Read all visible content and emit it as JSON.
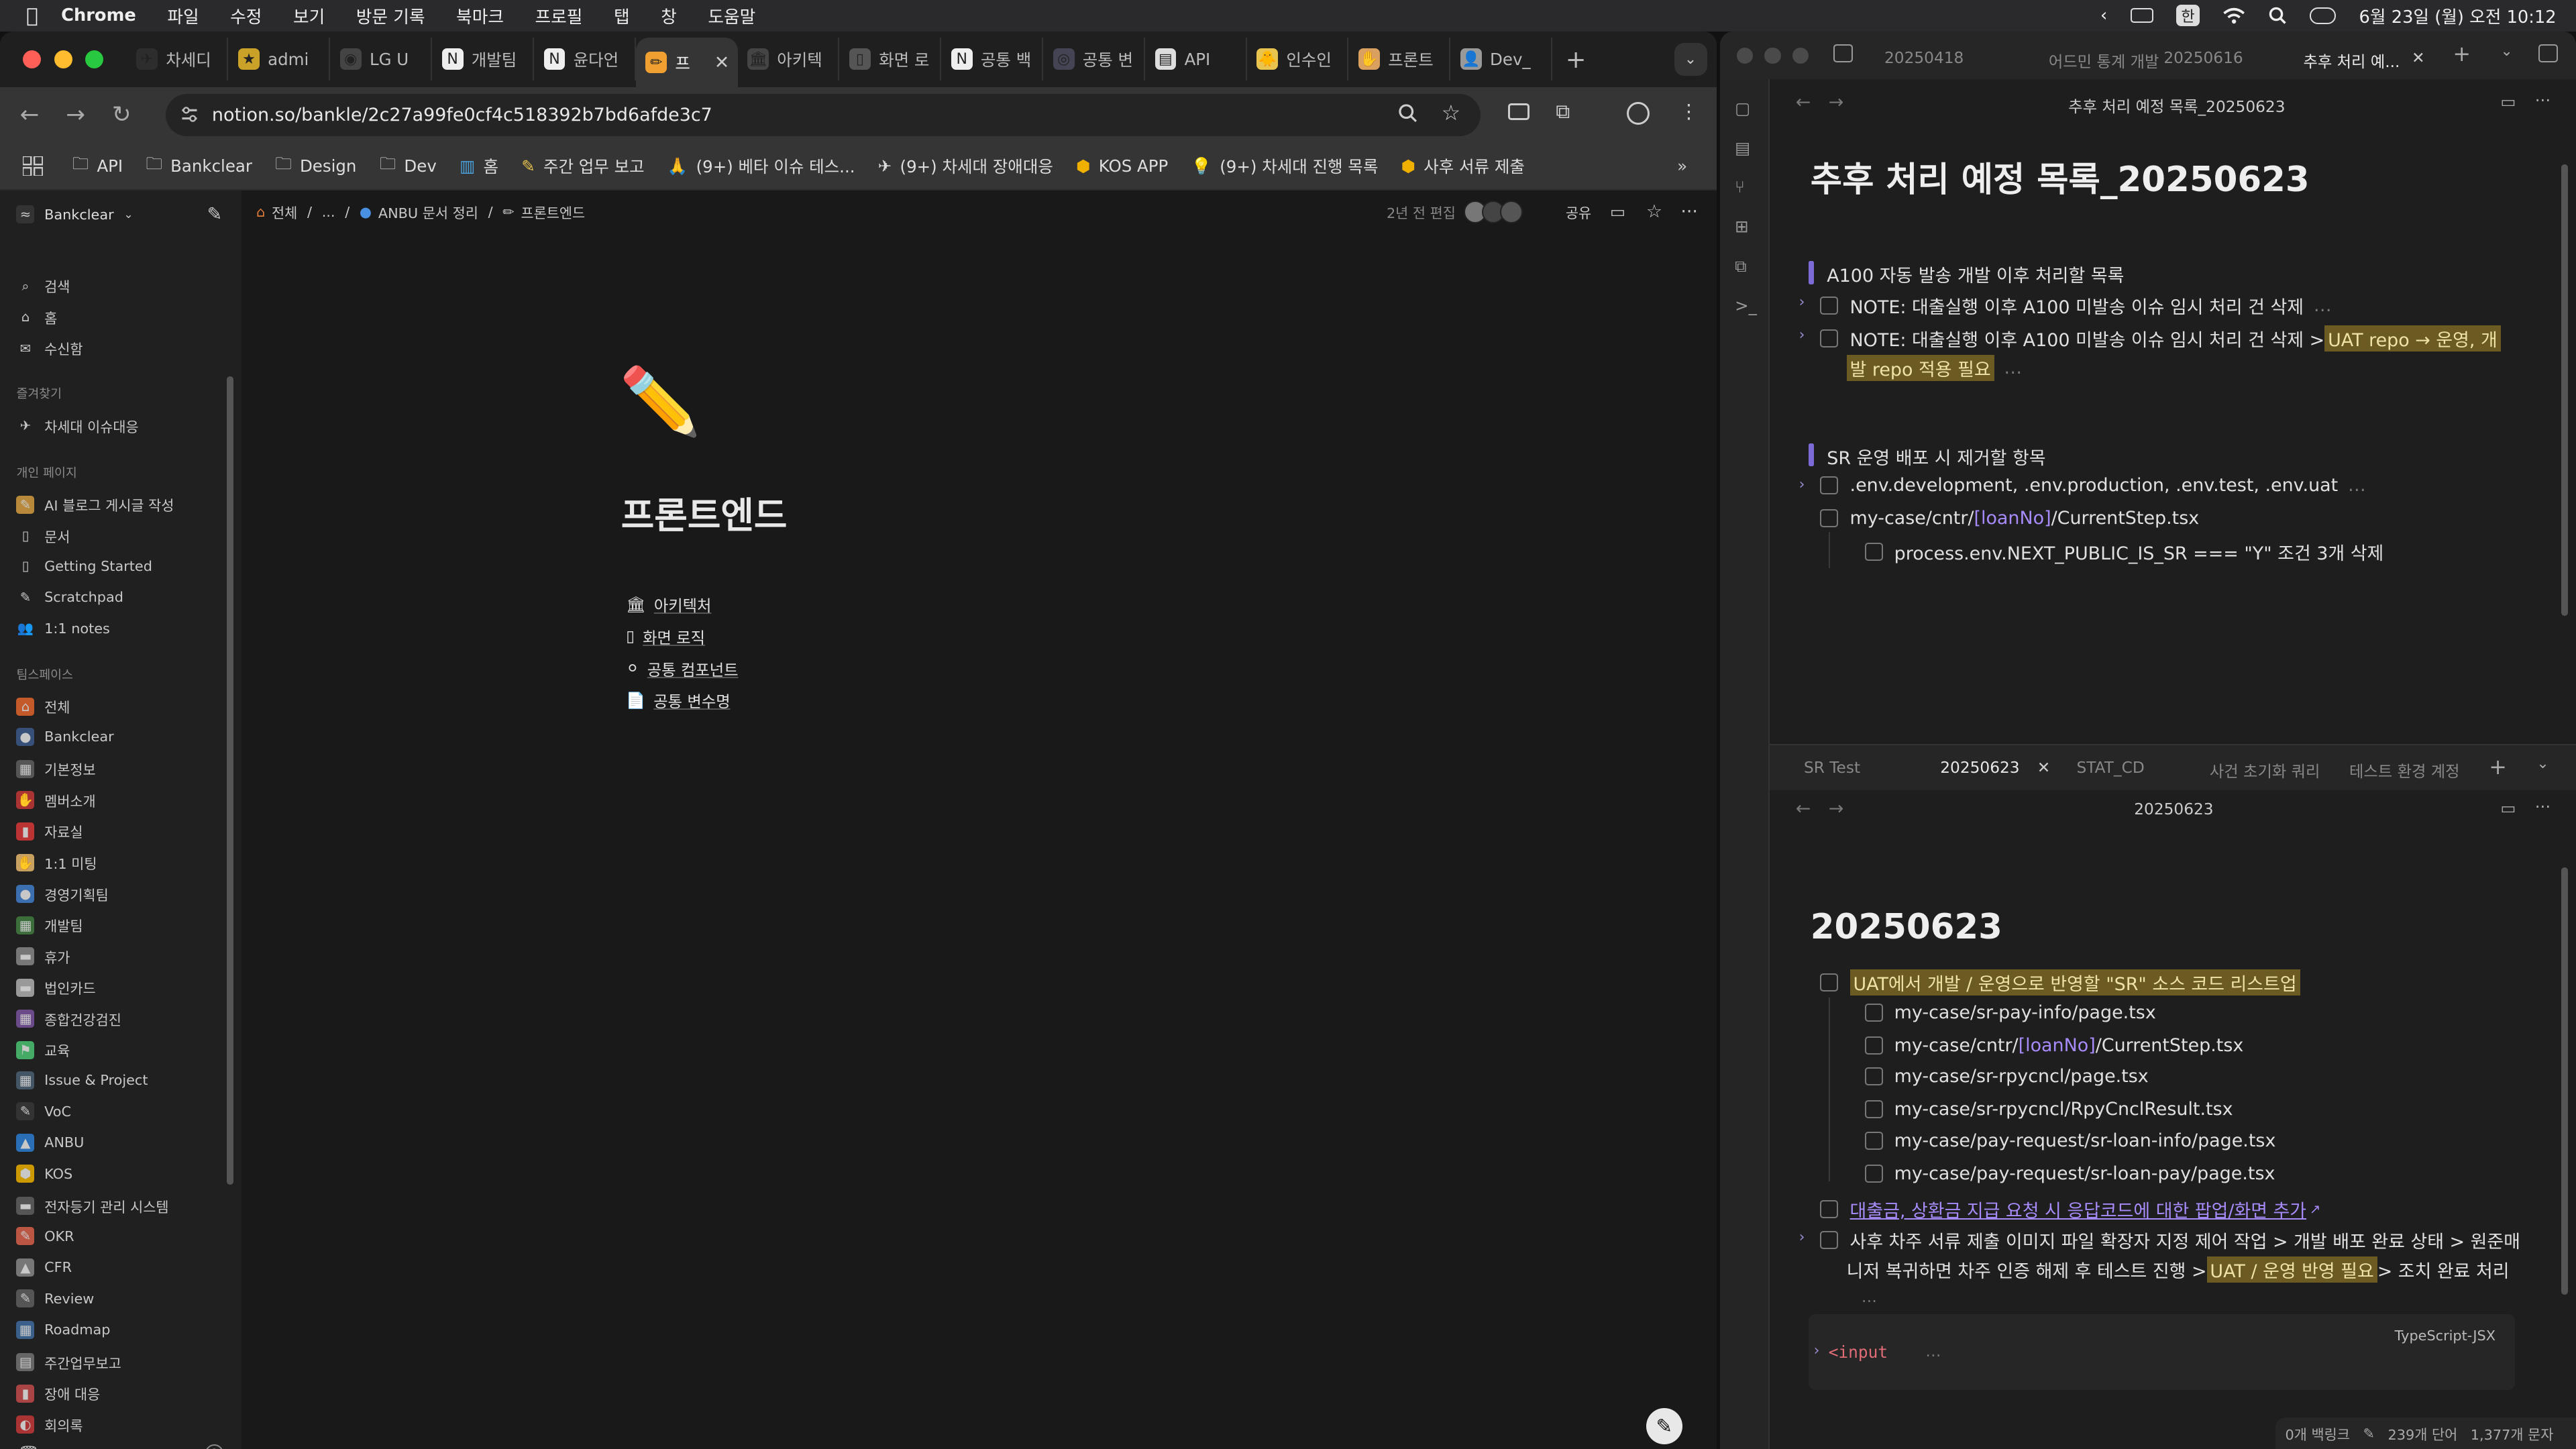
{
  "menubar": {
    "app": "Chrome",
    "items": [
      "파일",
      "수정",
      "보기",
      "방문 기록",
      "북마크",
      "프로필",
      "탭",
      "창",
      "도움말"
    ],
    "clock": "6월 23일 (월) 오전 10:12",
    "ime": "한"
  },
  "chrome": {
    "tabs": [
      {
        "label": "차세디",
        "fav": "✈",
        "bg": "#2d2d2d"
      },
      {
        "label": "admi",
        "fav": "★",
        "bg": "#c9a227"
      },
      {
        "label": "LG U",
        "fav": "◉",
        "bg": "#444"
      },
      {
        "label": "개발팀",
        "fav": "N",
        "bg": "#eee"
      },
      {
        "label": "윤다언",
        "fav": "N",
        "bg": "#eee"
      },
      {
        "label": "프",
        "fav": "✏",
        "bg": "#f0a030"
      },
      {
        "label": "아키텍",
        "fav": "🏛",
        "bg": "#444"
      },
      {
        "label": "화면 로",
        "fav": "▯",
        "bg": "#555"
      },
      {
        "label": "공통 백",
        "fav": "N",
        "bg": "#eee"
      },
      {
        "label": "공통 변",
        "fav": "◎",
        "bg": "#445"
      },
      {
        "label": "API",
        "fav": "▤",
        "bg": "#ddd"
      },
      {
        "label": "인수인",
        "fav": "🐥",
        "bg": "#e8c34d"
      },
      {
        "label": "프론트",
        "fav": "✋",
        "bg": "#d9a060"
      },
      {
        "label": "Dev_",
        "fav": "👤",
        "bg": "#999"
      }
    ],
    "active_tab_index": 5,
    "url": "notion.so/bankle/2c27a99fe0cf4c518392b7bd6afde3c7",
    "bookmarks": [
      "API",
      "Bankclear",
      "Design",
      "Dev",
      "홈",
      "주간 업무 보고",
      "(9+) 베타 이슈 테스...",
      "(9+) 차세대 장애대응",
      "KOS APP",
      "(9+) 차세대 진행 목록",
      "사후 서류 제출"
    ]
  },
  "notion": {
    "workspace": "Bankclear",
    "nav": [
      "검색",
      "홈",
      "수신함"
    ],
    "favorites_label": "즐겨찾기",
    "favorites": [
      "차세대 이슈대응"
    ],
    "personal_label": "개인 페이지",
    "personal": [
      "AI 블로그 게시글 작성",
      "문서",
      "Getting Started",
      "Scratchpad",
      "1:1 notes"
    ],
    "teamspace_label": "팀스페이스",
    "teamspace": [
      "전체",
      "Bankclear",
      "기본정보",
      "멤버소개",
      "자료실",
      "1:1 미팅",
      "경영기획팀",
      "개발팀",
      "휴가",
      "법인카드",
      "종합건강검진",
      "교육",
      "Issue & Project",
      "VoC",
      "ANBU",
      "KOS",
      "전자등기 관리 시스템",
      "OKR",
      "CFR",
      "Review",
      "Roadmap",
      "주간업무보고",
      "장애 대응",
      "회의록"
    ],
    "breadcrumb": [
      "전체",
      "...",
      "ANBU 문서 정리",
      "프론트엔드"
    ],
    "edited": "2년 전 편집",
    "share": "공유",
    "page_icon": "✏️",
    "page_title": "프론트엔드",
    "subpages": [
      {
        "icon": "🏛",
        "label": "아키텍처"
      },
      {
        "icon": "▯",
        "label": "화면 로직"
      },
      {
        "icon": "⚪",
        "label": "공통 컴포넌트"
      },
      {
        "icon": "📄",
        "label": "공통 변수명"
      }
    ]
  },
  "obsidian": {
    "top_tabs": [
      "20250418",
      "어드민 통계 개발",
      "20250616",
      "추후 처리 예..."
    ],
    "top_pane_title": "추후 처리 예정 목록_20250623",
    "top_h1": "추후 처리 예정 목록_20250623",
    "sec1_title": "A100 자동 발송 개발 이후 처리할 목록",
    "sec1_items": [
      "NOTE: 대출실행 이후 A100 미발송 이슈 임시 처리 건 삭제",
      "NOTE: 대출실행 이후 A100 미발송 이슈 임시 처리 건 삭제 > ",
      "UAT repo → 운영, 개",
      "발 repo 적용 필요"
    ],
    "sec2_title": "SR 운영 배포 시 제거할 항목",
    "sec2_items": [
      ".env.development, .env.production, .env.test, .env.uat",
      "my-case/cntr/",
      "[loanNo]",
      "/CurrentStep.tsx",
      "process.env.NEXT_PUBLIC_IS_SR === \"Y\" 조건 3개 삭제"
    ],
    "bottom_tabs": [
      "SR Test",
      "20250623",
      "STAT_CD",
      "사건 초기화 쿼리",
      "테스트 환경 계정"
    ],
    "bottom_pane_title": "20250623",
    "bottom_h1": "20250623",
    "todo_head": "UAT에서 개발 / 운영으로 반영할 \"SR\" 소스 코드 리스트업",
    "files": [
      "my-case/sr-pay-info/page.tsx",
      "my-case/cntr/",
      "[loanNo]",
      "/CurrentStep.tsx",
      "my-case/sr-rpycncl/page.tsx",
      "my-case/sr-rpycncl/RpyCnclResult.tsx",
      "my-case/pay-request/sr-loan-info/page.tsx",
      "my-case/pay-request/sr-loan-pay/page.tsx"
    ],
    "link_item": "대출금, 상환금 지급 요청 시 응답코드에 대한 팝업/화면 추가",
    "long_item_1": "사후 차주 서류 제출 이미지 파일 확장자 지정 제어 작업 > 개발 배포 완료 상태 > 원준매",
    "long_item_2": "니저 복귀하면 차주 인증 해제 후 테스트 진행 > ",
    "long_item_hl": "UAT / 운영 반영 필요",
    "long_item_3": " > 조치 완료 처리",
    "code_lang": "TypeScript-JSX",
    "code_text": "<input",
    "status": [
      "0개 백링크",
      "239개 단어",
      "1,377개 문자"
    ]
  }
}
